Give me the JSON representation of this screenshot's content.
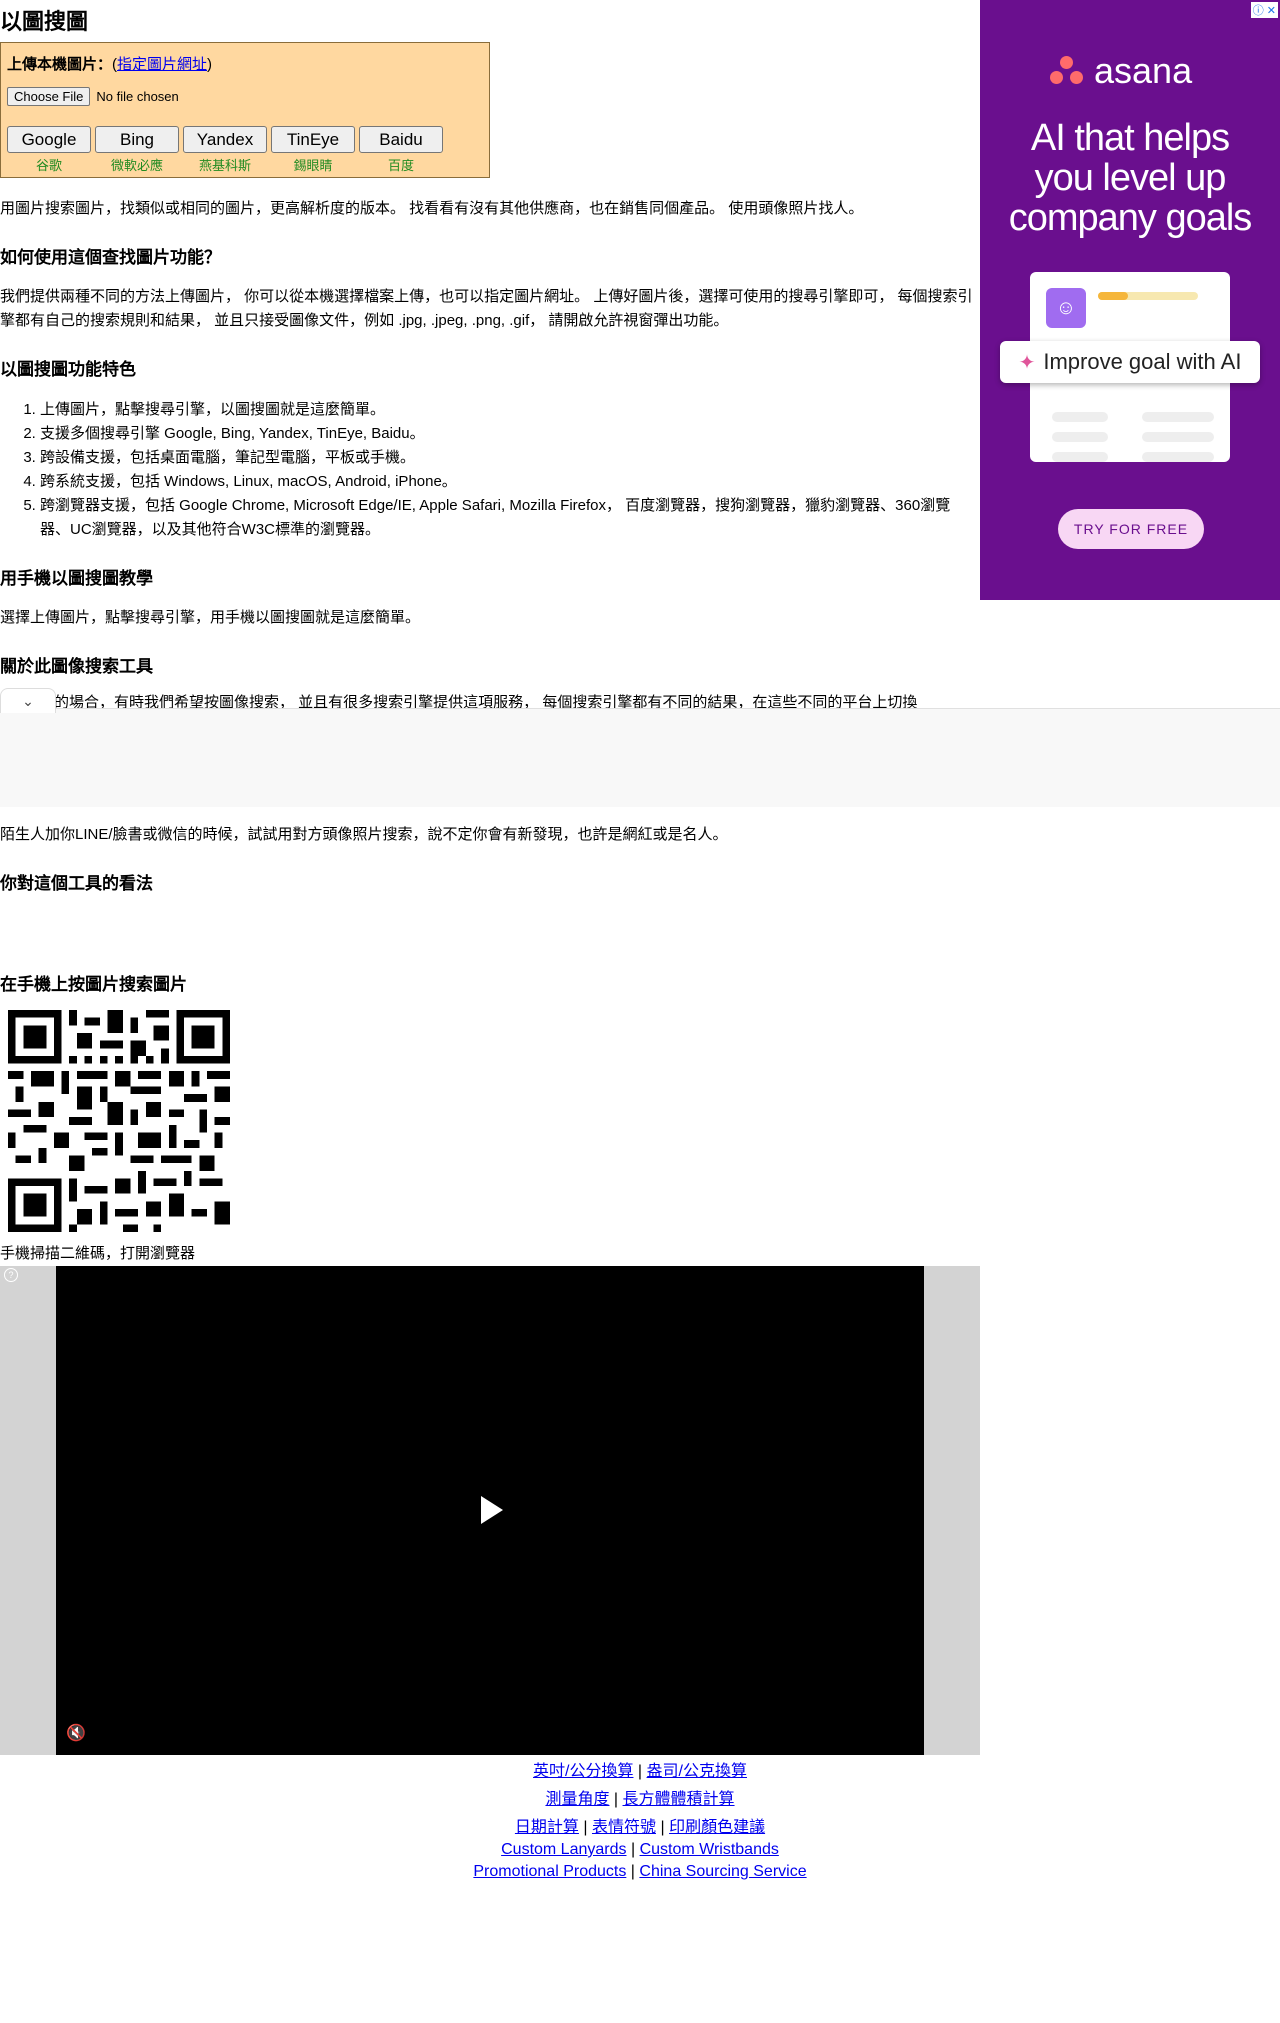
{
  "page": {
    "title": "以圖搜圖"
  },
  "upload": {
    "label": "上傳本機圖片：",
    "url_link_prefix": "(",
    "url_link": "指定圖片網址",
    "url_link_suffix": ")",
    "file_button": "Choose File",
    "file_status": "No file chosen"
  },
  "engines": [
    {
      "label": "Google",
      "cn": "谷歌"
    },
    {
      "label": "Bing",
      "cn": "微軟必應"
    },
    {
      "label": "Yandex",
      "cn": "燕基科斯"
    },
    {
      "label": "TinEye",
      "cn": "錫眼睛"
    },
    {
      "label": "Baidu",
      "cn": "百度"
    }
  ],
  "intro": "用圖片搜索圖片，找類似或相同的圖片，更高解析度的版本。 找看看有沒有其他供應商，也在銷售同個產品。 使用頭像照片找人。",
  "how": {
    "heading": "如何使用這個查找圖片功能？",
    "body": "我們提供兩種不同的方法上傳圖片， 你可以從本機選擇檔案上傳，也可以指定圖片網址。 上傳好圖片後，選擇可使用的搜尋引擎即可， 每個搜索引擎都有自己的搜索規則和結果， 並且只接受圖像文件，例如 .jpg, .jpeg, .png, .gif， 請開啟允許視窗彈出功能。"
  },
  "features": {
    "heading": "以圖搜圖功能特色",
    "items": [
      "上傳圖片，點擊搜尋引擎，以圖搜圖就是這麼簡單。",
      "支援多個搜尋引擎 Google, Bing, Yandex, TinEye, Baidu。",
      "跨設備支援，包括桌面電腦，筆記型電腦，平板或手機。",
      "跨系統支援，包括 Windows, Linux, macOS, Android, iPhone。",
      "跨瀏覽器支援，包括 Google Chrome, Microsoft Edge/IE, Apple Safari, Mozilla Firefox， 百度瀏覽器，搜狗瀏覽器，獵豹瀏覽器、360瀏覽器、UC瀏覽器，以及其他符合W3C標準的瀏覽器。"
    ]
  },
  "mobile": {
    "heading": "用手機以圖搜圖教學",
    "body": "選擇上傳圖片，點擊搜尋引擎，用手機以圖搜圖就是這麼簡單。"
  },
  "about": {
    "heading": "關於此圖像搜索工具",
    "body_partial": "的場合，有時我們希望按圖像搜索， 並且有很多搜索引擎提供這項服務， 每個搜索引擎都有不同的結果，在這些不同的平台上切換"
  },
  "stranger": "陌生人加你LINE/臉書或微信的時候，試試用對方頭像照片搜索，說不定你會有新發現，也許是網紅或是名人。",
  "opinion_heading": "你對這個工具的看法",
  "qr": {
    "heading": "在手機上按圖片搜索圖片",
    "caption": "手機掃描二維碼，打開瀏覽器"
  },
  "ad": {
    "brand": "asana",
    "headline_1": "AI that helps",
    "headline_2": "you level up",
    "headline_3": "company goals",
    "pill": "Improve goal with AI",
    "cta": "TRY FOR FREE",
    "close_icons": "ⓘ ✕",
    "brand_color": "#6a0f8e"
  },
  "video": {
    "play_icon": "play-icon",
    "mute_icon": "muted-speaker-icon"
  },
  "footer": {
    "row1": [
      "英吋/公分換算",
      "盎司/公克換算"
    ],
    "row2": [
      "測量角度",
      "長方體體積計算"
    ],
    "row3": [
      "日期計算",
      "表情符號",
      "印刷顏色建議"
    ],
    "row4": [
      "Custom Lanyards",
      "Custom Wristbands"
    ],
    "row5": [
      "Promotional Products",
      "China Sourcing Service"
    ],
    "sep": "|"
  }
}
